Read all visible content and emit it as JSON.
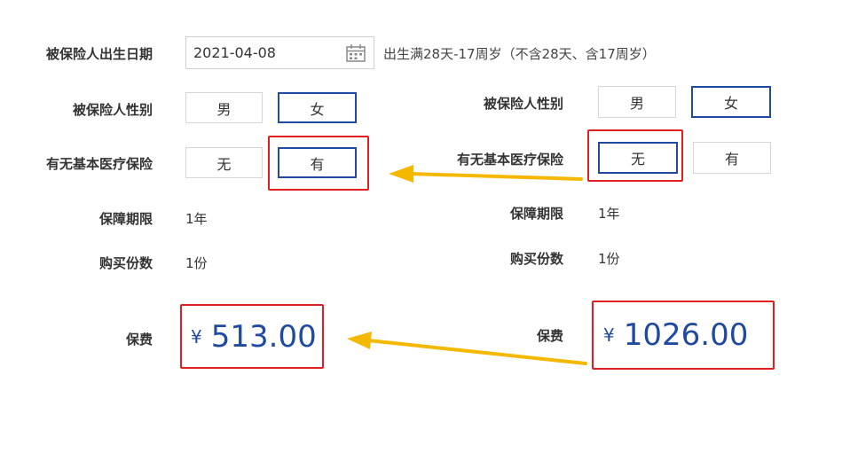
{
  "left": {
    "birth_label": "被保险人出生日期",
    "birth_value": "2021-04-08",
    "birth_note": "出生满28天-17周岁（不含28天、含17周岁）",
    "gender_label": "被保险人性别",
    "gender_options": [
      "男",
      "女"
    ],
    "gender_selected": "女",
    "medical_label": "有无基本医疗保险",
    "medical_options": [
      "无",
      "有"
    ],
    "medical_selected": "有",
    "period_label": "保障期限",
    "period_value": "1年",
    "copies_label": "购买份数",
    "copies_value": "1份",
    "premium_label": "保费",
    "currency": "¥",
    "premium_value": "513.00"
  },
  "right": {
    "gender_label": "被保险人性别",
    "gender_options": [
      "男",
      "女"
    ],
    "gender_selected": "女",
    "medical_label": "有无基本医疗保险",
    "medical_options": [
      "无",
      "有"
    ],
    "medical_selected": "无",
    "period_label": "保障期限",
    "period_value": "1年",
    "copies_label": "购买份数",
    "copies_value": "1份",
    "premium_label": "保费",
    "currency": "¥",
    "premium_value": "1026.00"
  },
  "colors": {
    "selected_border": "#1f4aa0",
    "highlight": "#e02020",
    "arrow": "#f5b800",
    "price": "#1f4aa0"
  },
  "icons": {
    "calendar": "calendar-icon",
    "arrow": "left-arrow-icon"
  }
}
